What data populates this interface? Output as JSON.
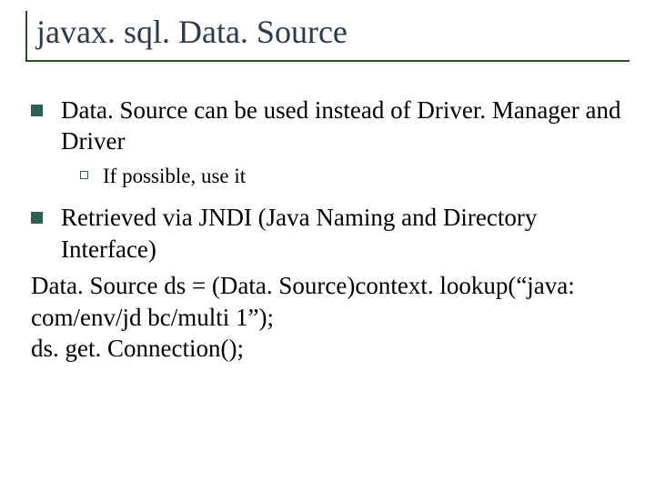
{
  "title": "javax. sql. Data. Source",
  "bullets": {
    "b1": "Data. Source can be used instead of Driver. Manager and Driver",
    "b1_sub": "If possible, use it",
    "b2": "Retrieved via JNDI (Java Naming and Directory Interface)",
    "code1": "Data. Source ds = (Data. Source)context. lookup(“java: com/env/jd bc/multi 1”);",
    "code2": "ds. get. Connection();"
  }
}
